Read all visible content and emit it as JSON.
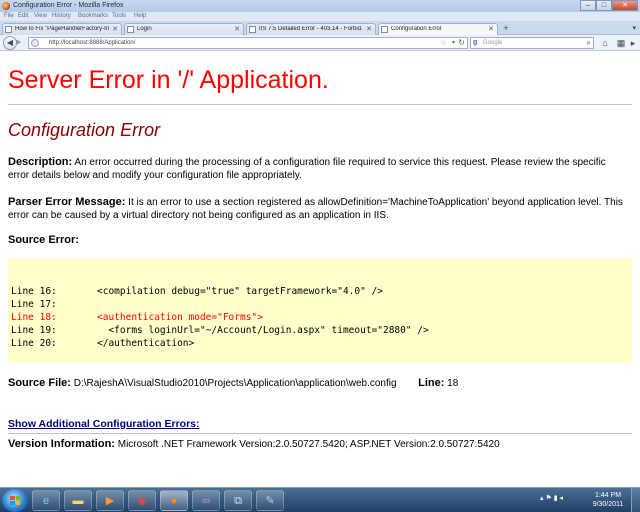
{
  "window": {
    "title": "Configuration Error - Mozilla Firefox",
    "controls": {
      "minimize": "–",
      "maximize": "□",
      "close": "✕"
    }
  },
  "menu": [
    "File",
    "Edit",
    "View",
    "History",
    "Bookmarks",
    "Tools",
    "Help"
  ],
  "tabs": [
    {
      "label": "How to Fix \"PageHandlerFactory-Inte...",
      "close": "✕"
    },
    {
      "label": "Login",
      "close": "✕"
    },
    {
      "label": "IIS 7.5 Detailed Error - 403.14 - Forbid...",
      "close": "✕"
    },
    {
      "label": "Configuration Error",
      "close": "✕"
    }
  ],
  "tab_new": "+",
  "nav": {
    "url": "http://localhost:8888/Application/",
    "search_placeholder": "Google",
    "search_engine_glyph": "g"
  },
  "page": {
    "heading": "Server Error in '/' Application.",
    "subheading": "Configuration Error",
    "description_label": "Description:",
    "description_text": " An error occurred during the processing of a configuration file required to service this request. Please review the specific error details below and modify your configuration file appropriately.",
    "parser_label": "Parser Error Message:",
    "parser_text": " It is an error to use a section registered as allowDefinition='MachineToApplication' beyond application level.  This error can be caused by a virtual directory not being configured as an application in IIS.",
    "source_error_label": "Source Error:",
    "code_lines": [
      {
        "num": "Line 16:",
        "code": "<compilation debug=\"true\" targetFramework=\"4.0\" />",
        "error": false
      },
      {
        "num": "Line 17:",
        "code": "",
        "error": false
      },
      {
        "num": "Line 18:",
        "code": "<authentication mode=\"Forms\">",
        "error": true
      },
      {
        "num": "Line 19:",
        "code": "  <forms loginUrl=\"~/Account/Login.aspx\" timeout=\"2880\" />",
        "error": false
      },
      {
        "num": "Line 20:",
        "code": "</authentication>",
        "error": false
      }
    ],
    "source_file_label": "Source File:",
    "source_file_value": " D:\\RajeshA\\VisualStudio2010\\Projects\\Application\\application\\web.config",
    "line_label": "Line:",
    "line_value": " 18",
    "show_errors_link": "Show Additional Configuration Errors:",
    "version_label": "Version Information:",
    "version_text": " Microsoft .NET Framework Version:2.0.50727.5420; ASP.NET Version:2.0.50727.5420"
  },
  "taskbar": {
    "apps": [
      "ie-icon",
      "explorer-folder-icon",
      "media-player-icon",
      "chrome-icon",
      "firefox-icon",
      "visual-studio-icon",
      "network-icon",
      "paint-icon"
    ],
    "time": "1:44 PM",
    "date": "9/30/2011"
  },
  "colors": {
    "heading": "#ff0000",
    "subheading": "#8b0000",
    "code_bg": "#ffffcc",
    "link": "#000080"
  }
}
